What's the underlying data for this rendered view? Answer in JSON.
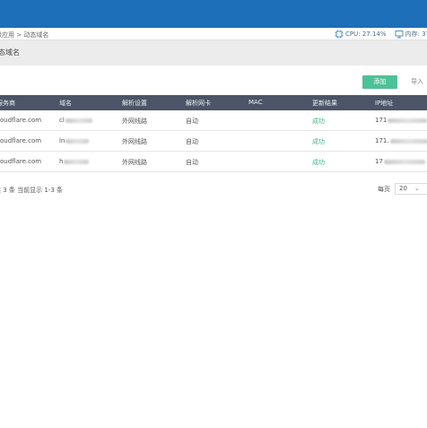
{
  "breadcrumb": "级应用 > 动态域名",
  "sysinfo": {
    "cpu": "CPU: 27.14%",
    "memory": "内存: 37"
  },
  "page_title": "态域名",
  "toolbar": {
    "add_label": "添加",
    "import_label": "导入"
  },
  "table": {
    "columns": [
      "服务商",
      "域名",
      "解析设置",
      "解析网卡",
      "MAC",
      "更新结果",
      "IP地址"
    ],
    "rows": [
      {
        "provider": "oudflare.com",
        "domain_prefix": "cl",
        "resolve": "外网线路",
        "nic": "自动",
        "mac": "",
        "result": "成功",
        "ip_prefix": "171"
      },
      {
        "provider": "oudflare.com",
        "domain_prefix": "ln",
        "resolve": "外网线路",
        "nic": "自动",
        "mac": "",
        "result": "成功",
        "ip_prefix": "171."
      },
      {
        "provider": "oudflare.com",
        "domain_prefix": "h",
        "resolve": "外网线路",
        "nic": "自动",
        "mac": "",
        "result": "成功",
        "ip_prefix": "17"
      }
    ]
  },
  "footer": {
    "summary": "共 3 条 当前显示 1-3 条",
    "per_page_label": "每页",
    "per_page_value": "20"
  },
  "colors": {
    "topbar": "#1c6fb8",
    "table_header": "#4b5567",
    "accent_green": "#4fc197",
    "success_text": "#3db781"
  },
  "icons": {
    "cpu": "cpu-chip-icon",
    "memory": "monitor-icon",
    "dropdown": "chevron-down-icon"
  }
}
